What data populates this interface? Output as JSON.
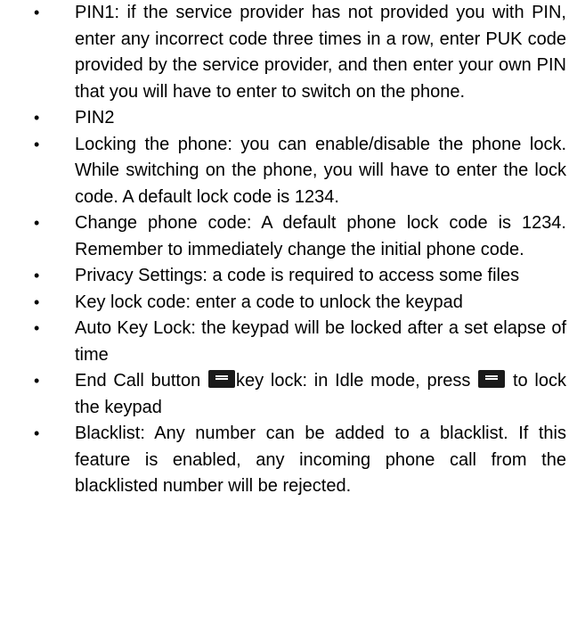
{
  "bullet_symbol": "•",
  "items": [
    {
      "text": "PIN1: if the service provider has not provided you with PIN, enter any incorrect code three times in a row, enter PUK code provided by the service provider, and then enter your own PIN that you will have to enter to switch on the phone."
    },
    {
      "text": "PIN2"
    },
    {
      "text": "Locking the phone: you can enable/disable the phone lock. While switching on the phone, you will have to enter the lock code. A default lock code is 1234."
    },
    {
      "text": "Change phone code: A default phone lock code is 1234. Remember to immediately change the initial phone code."
    },
    {
      "text": "Privacy Settings: a code is required to access some files"
    },
    {
      "text": "Key lock code: enter a code to unlock the keypad"
    },
    {
      "text": "Auto Key Lock: the keypad will be locked after a set elapse of time"
    },
    {
      "part1": "End Call button ",
      "part2": "key lock: in Idle mode, press ",
      "part3": " to lock the keypad",
      "icon": "end-call-key-icon"
    },
    {
      "text": "Blacklist: Any number can be added to a blacklist. If this feature is enabled, any incoming phone call from the blacklisted number will be rejected."
    }
  ]
}
